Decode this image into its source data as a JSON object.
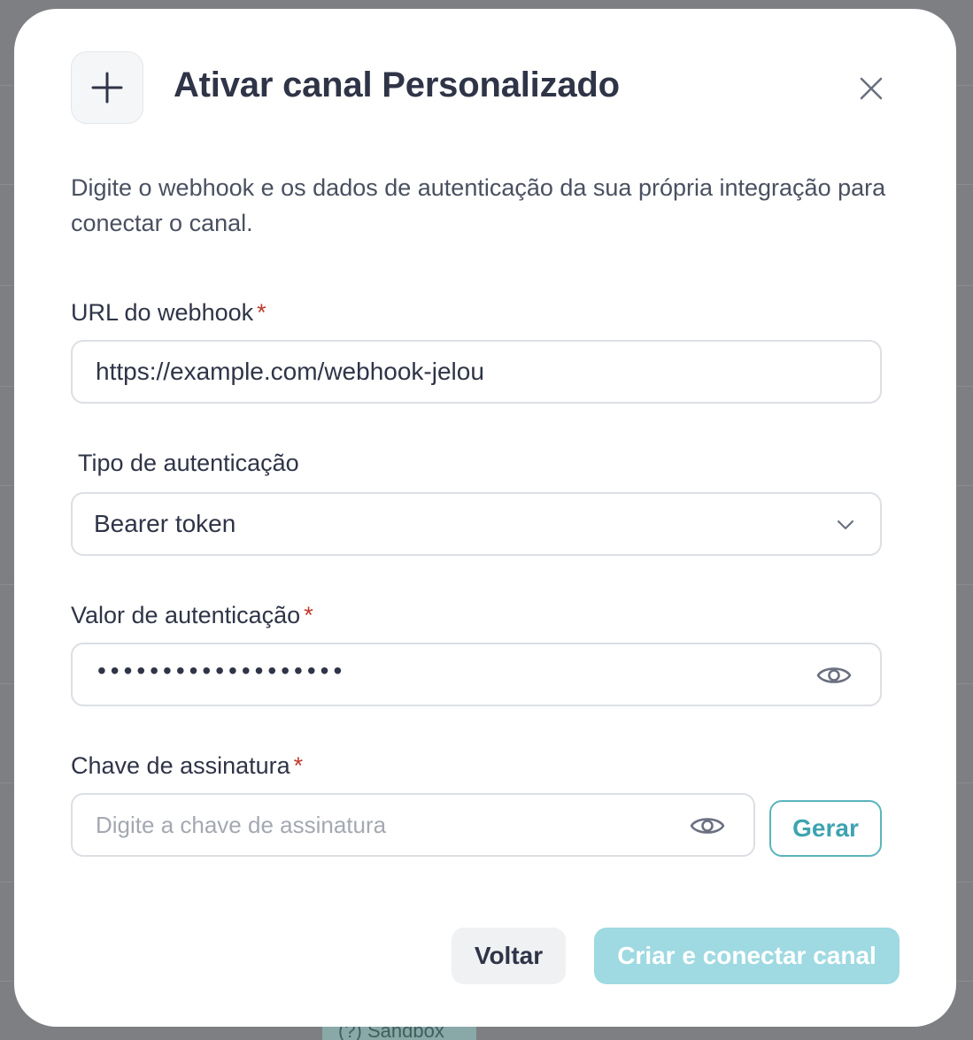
{
  "background": {
    "sandbox_badge": "(?) Sandbox"
  },
  "modal": {
    "title": "Ativar canal Personalizado",
    "description": "Digite o webhook e os dados de autenticação da sua própria integração para conectar o canal.",
    "webhook": {
      "label": "URL do webhook",
      "required_mark": "*",
      "value": "https://example.com/webhook-jelou"
    },
    "auth_type": {
      "label": "Tipo de autenticação",
      "selected": "Bearer token"
    },
    "auth_value": {
      "label": "Valor de autenticação",
      "required_mark": "*",
      "masked_value": "•••••••••••••••••••"
    },
    "signature_key": {
      "label": "Chave de assinatura",
      "required_mark": "*",
      "placeholder": "Digite a chave de assinatura",
      "value": ""
    },
    "generate_button": "Gerar",
    "back_button": "Voltar",
    "submit_button": "Criar e conectar canal"
  },
  "icons": {
    "header": "plus-icon",
    "close": "close-icon",
    "select": "chevron-down-icon",
    "reveal": "eye-icon"
  },
  "colors": {
    "accent": "#3fa3b0",
    "primary_disabled": "#9fd9e2",
    "required": "#c0392b",
    "title": "#2f3447"
  }
}
